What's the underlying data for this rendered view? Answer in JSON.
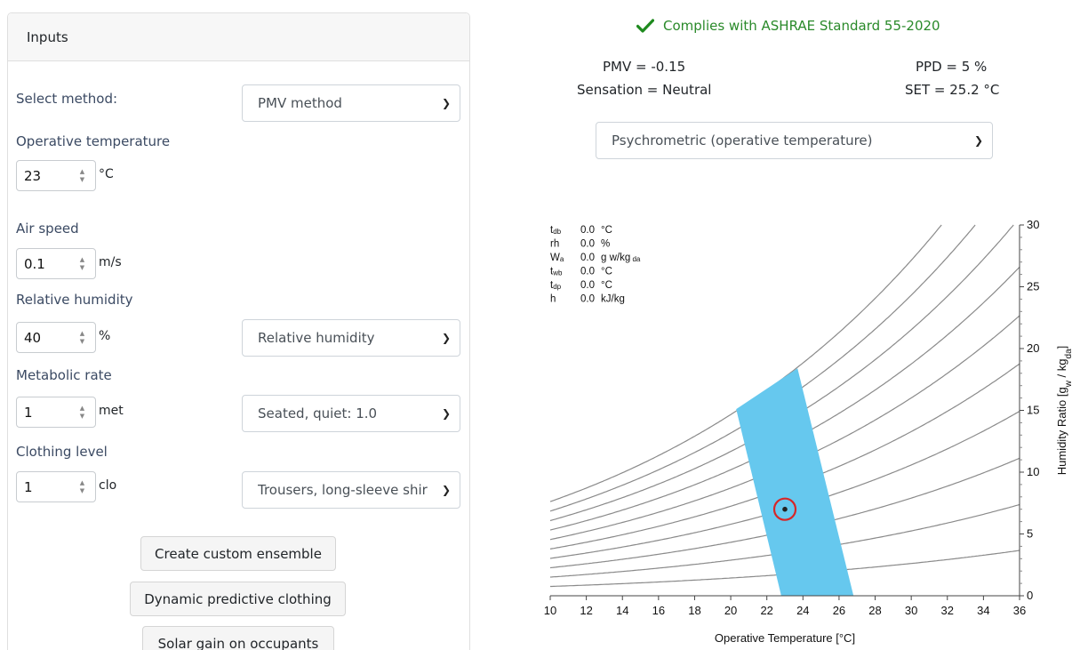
{
  "inputs": {
    "header": "Inputs",
    "method_label": "Select method:",
    "method_value": "PMV method",
    "op_temp_label": "Operative temperature",
    "op_temp_value": "23",
    "op_temp_unit": "°C",
    "air_speed_label": "Air speed",
    "air_speed_value": "0.1",
    "air_speed_unit": "m/s",
    "rh_label": "Relative humidity",
    "rh_value": "40",
    "rh_unit": "%",
    "rh_select": "Relative humidity",
    "met_label": "Metabolic rate",
    "met_value": "1",
    "met_unit": "met",
    "met_select": "Seated, quiet: 1.0",
    "clo_label": "Clothing level",
    "clo_value": "1",
    "clo_unit": "clo",
    "clo_select": "Trousers, long-sleeve shir",
    "btn_custom": "Create custom ensemble",
    "btn_dynamic": "Dynamic predictive clothing",
    "btn_solar": "Solar gain on occupants"
  },
  "results": {
    "compliance": "Complies with ASHRAE Standard 55-2020",
    "pmv": "PMV = -0.15",
    "ppd": "PPD = 5 %",
    "sensation": "Sensation = Neutral",
    "set": "SET = 25.2 °C",
    "chart_select": "Psychrometric (operative temperature)"
  },
  "readout": [
    {
      "sym": "t",
      "sub": "db",
      "val": "0.0",
      "unit": "°C",
      "unit_sub": ""
    },
    {
      "sym": "rh",
      "sub": "",
      "val": "0.0",
      "unit": "%",
      "unit_sub": ""
    },
    {
      "sym": "W",
      "sub": "a",
      "val": "0.0",
      "unit": "g w/kg",
      "unit_sub": "da"
    },
    {
      "sym": "t",
      "sub": "wb",
      "val": "0.0",
      "unit": "°C",
      "unit_sub": ""
    },
    {
      "sym": "t",
      "sub": "dp",
      "val": "0.0",
      "unit": "°C",
      "unit_sub": ""
    },
    {
      "sym": "h",
      "sub": "",
      "val": "0.0",
      "unit": "kJ/kg",
      "unit_sub": ""
    }
  ],
  "chart_data": {
    "type": "line",
    "xlabel": "Operative Temperature [°C]",
    "ylabel": "Humidity Ratio [g_w / kg_da]",
    "xlim": [
      10,
      36
    ],
    "ylim": [
      0,
      30
    ],
    "x_ticks": [
      10,
      12,
      14,
      16,
      18,
      20,
      22,
      24,
      26,
      28,
      30,
      32,
      34,
      36
    ],
    "y_ticks": [
      0,
      5,
      10,
      15,
      20,
      25,
      30
    ],
    "rh_curves_percent": [
      10,
      20,
      30,
      40,
      50,
      60,
      70,
      80,
      90,
      100
    ],
    "comfort_zone": [
      [
        22.8,
        0
      ],
      [
        26.8,
        0
      ],
      [
        23.7,
        18.4
      ],
      [
        20.3,
        15.1
      ]
    ],
    "current_point": {
      "x": 23,
      "y": 7
    },
    "colors": {
      "zone": "#66c8ee",
      "curve": "#8a8a8a",
      "point": "#d62728"
    }
  }
}
